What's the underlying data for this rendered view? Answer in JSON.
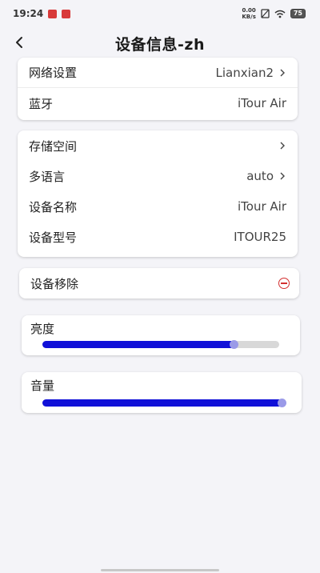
{
  "status_bar": {
    "time": "19:24",
    "network_speed": "0.00\nKB/s",
    "battery": "75"
  },
  "header": {
    "title": "设备信息-zh"
  },
  "network_card": {
    "wifi_label": "网络设置",
    "wifi_value": "Lianxian2",
    "bluetooth_label": "蓝牙",
    "bluetooth_value": "iTour Air"
  },
  "info_card": {
    "storage_label": "存储空间",
    "language_label": "多语言",
    "language_value": "auto",
    "name_label": "设备名称",
    "name_value": "iTour Air",
    "model_label": "设备型号",
    "model_value": "ITOUR25"
  },
  "remove_card": {
    "label": "设备移除"
  },
  "brightness": {
    "label": "亮度",
    "level": 0.81
  },
  "volume": {
    "label": "音量",
    "level": 1.0
  },
  "colors": {
    "slider_fill": "#1010d8",
    "slider_thumb": "#9a9ae8",
    "remove_accent": "#d32f2f"
  }
}
